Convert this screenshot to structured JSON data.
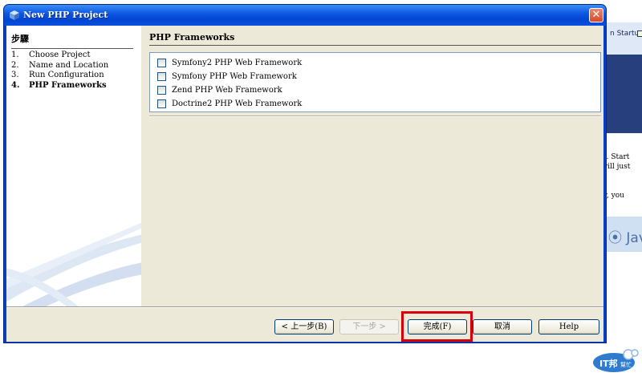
{
  "dialog": {
    "title": "New PHP Project",
    "close_label": "✕",
    "steps_title": "步驟",
    "steps": [
      {
        "num": "1.",
        "label": "Choose Project",
        "current": false
      },
      {
        "num": "2.",
        "label": "Name and Location",
        "current": false
      },
      {
        "num": "3.",
        "label": "Run Configuration",
        "current": false
      },
      {
        "num": "4.",
        "label": "PHP Frameworks",
        "current": true
      }
    ],
    "pane_title": "PHP Frameworks",
    "frameworks": [
      {
        "label": "Symfony2 PHP Web Framework",
        "checked": false
      },
      {
        "label": "Symfony PHP Web Framework",
        "checked": false
      },
      {
        "label": "Zend PHP Web Framework",
        "checked": false
      },
      {
        "label": "Doctrine2 PHP Web Framework",
        "checked": false
      }
    ],
    "buttons": {
      "back": "< 上一步(B)",
      "next": "下一步 >",
      "finish": "完成(F)",
      "cancel": "取消",
      "help": "Help"
    },
    "highlight_color": "#d6000b"
  },
  "background": {
    "startup_text": "n Startup",
    "text_lines": [
      "t. Start",
      "vill just",
      "",
      "",
      "y, you"
    ],
    "java_text": "Java",
    "logo_text": "IT邦幫忙"
  }
}
